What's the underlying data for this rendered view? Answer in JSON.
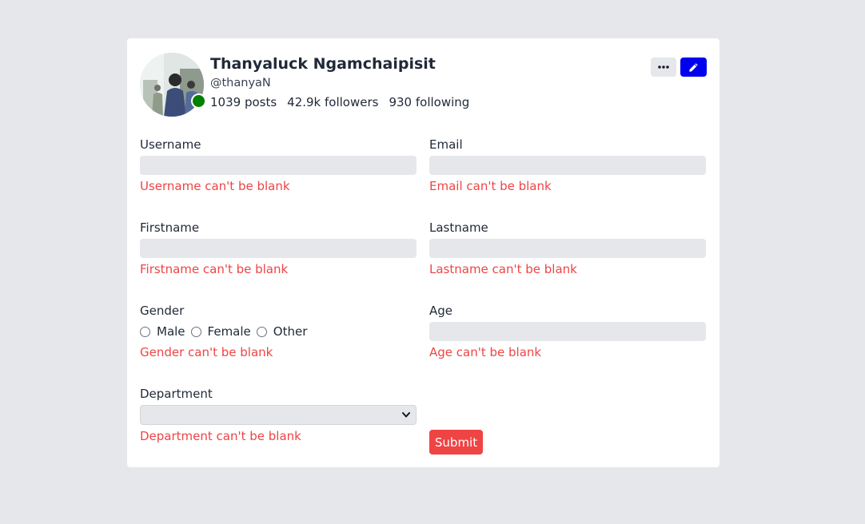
{
  "profile": {
    "name": "Thanyaluck Ngamchaipisit",
    "handle": "@thanyaN",
    "posts": "1039 posts",
    "followers": "42.9k followers",
    "following": "930 following",
    "status_color": "#008000"
  },
  "actions": {
    "more_icon": "ellipsis-icon",
    "edit_icon": "pencil-icon",
    "edit_color": "#0000ee"
  },
  "form": {
    "username": {
      "label": "Username",
      "value": "",
      "error": "Username can't be blank"
    },
    "email": {
      "label": "Email",
      "value": "",
      "error": "Email can't be blank"
    },
    "firstname": {
      "label": "Firstname",
      "value": "",
      "error": "Firstname can't be blank"
    },
    "lastname": {
      "label": "Lastname",
      "value": "",
      "error": "Lastname can't be blank"
    },
    "gender": {
      "label": "Gender",
      "options": [
        "Male",
        "Female",
        "Other"
      ],
      "error": "Gender can't be blank"
    },
    "age": {
      "label": "Age",
      "value": "",
      "error": "Age can't be blank"
    },
    "department": {
      "label": "Department",
      "selected": "",
      "error": "Department can't be blank"
    },
    "submit_label": "Submit",
    "error_color": "#ef4444"
  }
}
